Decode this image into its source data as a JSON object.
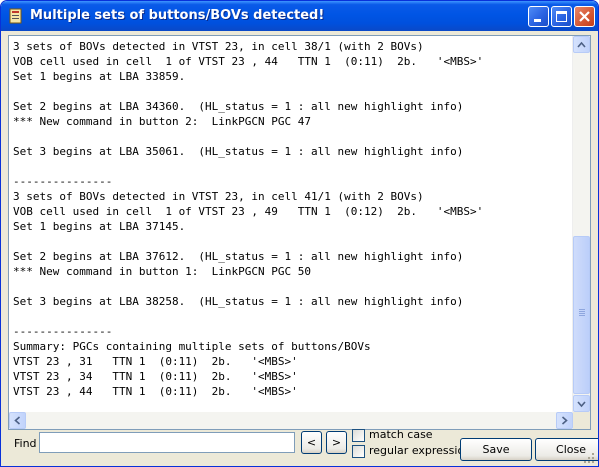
{
  "window": {
    "title": "Multiple sets of buttons/BOVs detected!"
  },
  "log_lines": [
    "3 sets of BOVs detected in VTST 23, in cell 38/1 (with 2 BOVs)",
    "VOB cell used in cell  1 of VTST 23 , 44   TTN 1  (0:11)  2b.   '<MBS>'",
    "Set 1 begins at LBA 33859.",
    "",
    "Set 2 begins at LBA 34360.  (HL_status = 1 : all new highlight info)",
    "*** New command in button 2:  LinkPGCN PGC 47",
    "",
    "Set 3 begins at LBA 35061.  (HL_status = 1 : all new highlight info)",
    "",
    "---------------",
    "3 sets of BOVs detected in VTST 23, in cell 41/1 (with 2 BOVs)",
    "VOB cell used in cell  1 of VTST 23 , 49   TTN 1  (0:12)  2b.   '<MBS>'",
    "Set 1 begins at LBA 37145.",
    "",
    "Set 2 begins at LBA 37612.  (HL_status = 1 : all new highlight info)",
    "*** New command in button 1:  LinkPGCN PGC 50",
    "",
    "Set 3 begins at LBA 38258.  (HL_status = 1 : all new highlight info)",
    "",
    "---------------",
    "Summary: PGCs containing multiple sets of buttons/BOVs",
    "VTST 23 , 31   TTN 1  (0:11)  2b.   '<MBS>'",
    "VTST 23 , 34   TTN 1  (0:11)  2b.   '<MBS>'",
    "VTST 23 , 44   TTN 1  (0:11)  2b.   '<MBS>'"
  ],
  "find": {
    "label": "Find",
    "value": "",
    "prev_label": "<",
    "next_label": ">",
    "match_case_label": "match case",
    "regex_label": "regular expression",
    "match_case_checked": false,
    "regex_checked": false
  },
  "buttons": {
    "save": "Save",
    "close": "Close"
  },
  "colors": {
    "titlebar": "#0055e5",
    "close_button": "#d65a36",
    "face": "#ece9d8",
    "scrollbar": "#c1d3fb"
  },
  "icons": [
    "app-icon",
    "minimize-icon",
    "maximize-icon",
    "close-icon",
    "scroll-up-arrow-icon",
    "scroll-down-arrow-icon",
    "scroll-left-arrow-icon",
    "scroll-right-arrow-icon",
    "size-grip-icon"
  ]
}
